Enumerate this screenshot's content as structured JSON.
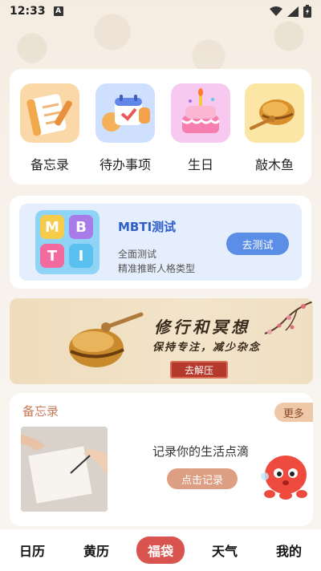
{
  "status_bar": {
    "time": "12:33",
    "notification_glyph": "A"
  },
  "tools": [
    {
      "label": "备忘录",
      "icon": "memo-notebook-icon"
    },
    {
      "label": "待办事项",
      "icon": "todo-calendar-icon"
    },
    {
      "label": "生日",
      "icon": "birthday-cake-icon"
    },
    {
      "label": "敲木鱼",
      "icon": "wooden-fish-icon"
    }
  ],
  "mbti": {
    "logo_letters": [
      "M",
      "B",
      "T",
      "I"
    ],
    "title": "MBTI测试",
    "line1": "全面测试",
    "line2": "精准推断人格类型",
    "button": "去测试"
  },
  "banner": {
    "title": "修行和冥想",
    "subtitle": "保持专注，减少杂念",
    "button": "去解压"
  },
  "memo": {
    "title": "备忘录",
    "more": "更多",
    "prompt": "记录你的生活点滴",
    "button": "点击记录"
  },
  "nav": {
    "items": [
      "日历",
      "黄历",
      "福袋",
      "天气",
      "我的"
    ],
    "active": "福袋"
  },
  "colors": {
    "accent_red": "#d9534f",
    "mbti_blue": "#5b8ee6",
    "memo_orange": "#dd9f83"
  }
}
